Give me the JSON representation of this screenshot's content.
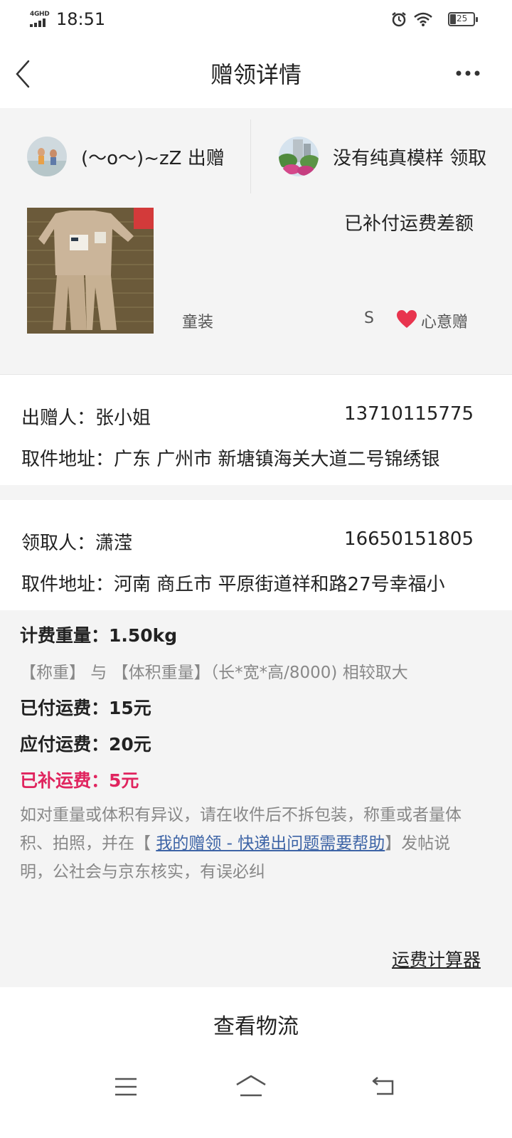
{
  "status_bar": {
    "network": "4GHD",
    "time": "18:51",
    "battery": "25"
  },
  "header": {
    "title": "赠领详情"
  },
  "parties": {
    "giver_label": "(～o～)~zZ 出赠",
    "receiver_label": "没有纯真模样 领取"
  },
  "item": {
    "status": "已补付运费差额",
    "category": "童装",
    "size": "S",
    "gift_type": "心意赠"
  },
  "giver": {
    "name_label": "出赠人：",
    "name": "张小姐",
    "phone": "13710115775",
    "address_label": "取件地址：",
    "address": "广东 广州市 新塘镇海关大道二号锦绣银"
  },
  "receiver": {
    "name_label": "领取人：",
    "name": "潇滢",
    "phone": "16650151805",
    "address_label": "取件地址：",
    "address": "河南 商丘市 平原街道祥和路27号幸福小"
  },
  "fees": {
    "weight": "计费重量：1.50kg",
    "weight_note": "【称重】 与 【体积重量】（长*宽*高/8000) 相较取大",
    "paid": "已付运费：15元",
    "payable": "应付运费：20元",
    "supplement": "已补运费：5元",
    "disclaimer_pre": "如对重量或体积有异议，请在收件后不拆包装，称重或者量体积、拍照，并在【 ",
    "disclaimer_link": "我的赠领 - 快递出问题需要帮助",
    "disclaimer_post": "】发帖说明，公社会与京东核实，有误必纠"
  },
  "calculator_link": "运费计算器",
  "logistics_button": "查看物流",
  "colors": {
    "accent_red": "#e0245e",
    "link_blue": "#3d64a6",
    "heart": "#e8344e"
  }
}
